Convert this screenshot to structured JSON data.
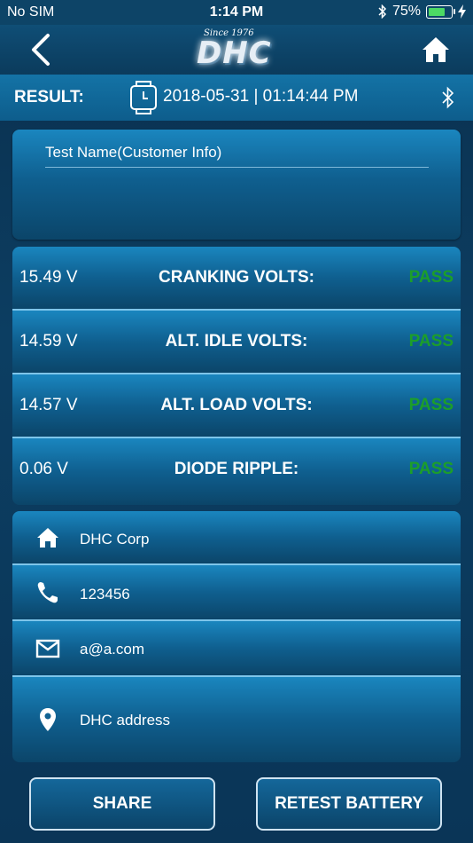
{
  "status_bar": {
    "carrier": "No SIM",
    "time": "1:14 PM",
    "battery_percent": "75%",
    "battery_level": 0.75
  },
  "nav": {
    "logo_tagline": "Since 1976",
    "logo_text": "DHC"
  },
  "result_header": {
    "label": "RESULT:",
    "datetime": "2018-05-31 | 01:14:44 PM"
  },
  "customer": {
    "title": "Test Name(Customer  Info)"
  },
  "tests": [
    {
      "value": "15.49 V",
      "name": "CRANKING VOLTS:",
      "status": "PASS"
    },
    {
      "value": "14.59 V",
      "name": "ALT. IDLE VOLTS:",
      "status": "PASS"
    },
    {
      "value": "14.57 V",
      "name": "ALT. LOAD VOLTS:",
      "status": "PASS"
    },
    {
      "value": "0.06 V",
      "name": "DIODE RIPPLE:",
      "status": "PASS"
    }
  ],
  "contact": {
    "company": "DHC Corp",
    "phone": "123456",
    "email": "a@a.com",
    "address": "DHC address"
  },
  "buttons": {
    "share": "SHARE",
    "retest": "RETEST BATTERY"
  },
  "colors": {
    "pass": "#1c9e2a",
    "accent": "#1473a6"
  }
}
